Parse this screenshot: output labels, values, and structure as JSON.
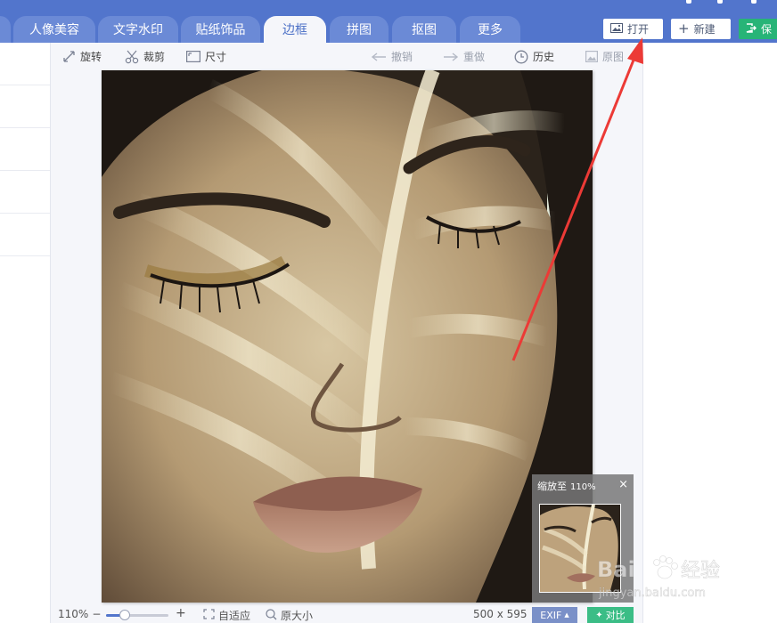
{
  "tabs": [
    {
      "label": "人像美容"
    },
    {
      "label": "文字水印"
    },
    {
      "label": "贴纸饰品"
    },
    {
      "label": "边框"
    },
    {
      "label": "拼图"
    },
    {
      "label": "抠图"
    },
    {
      "label": "更多"
    }
  ],
  "active_tab": "边框",
  "top_buttons": {
    "open_label": "打开",
    "new_label": "新建",
    "save_label": "保"
  },
  "toolbar": {
    "rotate": "旋转",
    "crop": "裁剪",
    "size": "尺寸",
    "undo": "撤销",
    "redo": "重做",
    "history": "历史",
    "original": "原图"
  },
  "navigator": {
    "title": "缩放至",
    "zoom": "110%",
    "close": "×"
  },
  "status": {
    "zoom": "110%",
    "zoom_level": 0.3,
    "minus": "−",
    "plus": "+",
    "fit_label": "自适应",
    "actual_label": "原大小",
    "dimensions": "500 x 595",
    "exif_label": "EXIF",
    "compare_label": "对比"
  },
  "watermark": {
    "brand": "Baidu经验",
    "url": "jingyan.baidu.com"
  },
  "colors": {
    "topbar": "#5275cc",
    "accent_green": "#27b477",
    "annotation_red": "#ec3a36"
  }
}
